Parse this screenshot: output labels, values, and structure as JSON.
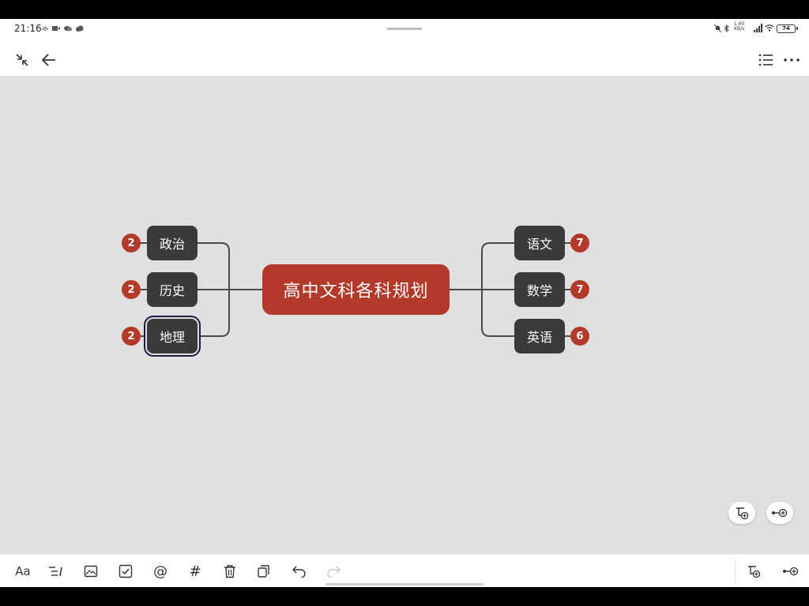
{
  "status_bar": {
    "time": "21:16",
    "net_speed_value": "1.60",
    "net_speed_unit": "KB/s",
    "battery": "74",
    "icons": [
      "cast-icon",
      "video-icon",
      "chat-icon",
      "cloud-icon",
      "mute-icon",
      "bluetooth-icon",
      "signal-icon",
      "wifi-icon",
      "battery-icon"
    ]
  },
  "top_bar": {
    "icons": [
      "collapse-icon",
      "back-arrow-icon",
      "outline-list-icon",
      "more-icon"
    ]
  },
  "mindmap": {
    "central_topic": "高中文科各科规划",
    "left_topics": [
      {
        "label": "政治",
        "count": "2"
      },
      {
        "label": "历史",
        "count": "2"
      },
      {
        "label": "地理",
        "count": "2",
        "selected": true
      }
    ],
    "right_topics": [
      {
        "label": "语文",
        "count": "7"
      },
      {
        "label": "数学",
        "count": "7"
      },
      {
        "label": "英语",
        "count": "6"
      }
    ],
    "colors": {
      "central": "#b33a2a",
      "node": "#3a3a3a",
      "badge": "#b33a2a",
      "canvas": "#e0e0e0",
      "line": "#4a4a4a"
    }
  },
  "toolbar": {
    "text_style_label": "Aa",
    "tag_label": "#",
    "mention_label": "@",
    "icons": [
      "text-style-icon",
      "list-icon",
      "image-icon",
      "checkbox-icon",
      "mention-icon",
      "tag-icon",
      "trash-icon",
      "copy-icon",
      "undo-icon",
      "redo-icon",
      "add-subtopic-icon",
      "add-sibling-icon"
    ]
  }
}
